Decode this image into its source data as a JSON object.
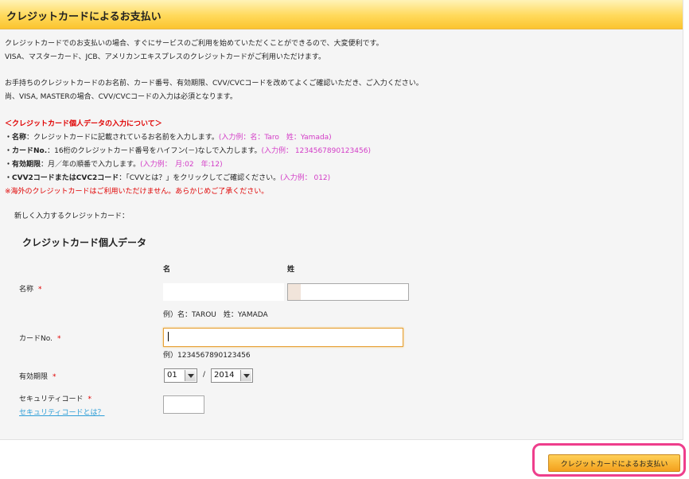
{
  "header": {
    "title": "クレジットカードによるお支払い"
  },
  "intro": {
    "line1": "クレジットカードでのお支払いの場合、すぐにサービスのご利用を始めていただくことができるので、大変便利です。",
    "line2": "VISA、マスターカード、JCB、アメリカンエキスプレスのクレジットカードがご利用いただけます。",
    "line3": "お手持ちのクレジットカードのお名前、カード番号、有効期限、CVV/CVCコードを改めてよくご確認いただき、ご入力ください。",
    "line4": "尚、VISA, MASTERの場合、CVV/CVCコードの入力は必須となります。"
  },
  "notes": {
    "heading": "＜クレジットカード個人データの入力について＞",
    "items": [
      {
        "label": "・名称",
        "text": "：クレジットカードに記載されているお名前を入力します。",
        "example": "(入力例：名：Taro　姓：Yamada)"
      },
      {
        "label": "・カードNo.",
        "text": "：16桁のクレジットカード番号をハイフン(－)なしで入力します。",
        "example": "(入力例： 1234567890123456)"
      },
      {
        "label": "・有効期限",
        "text": "：月／年の順番で入力します。",
        "example": "(入力例：　月:02　年:12)"
      },
      {
        "label": "・CVV2コードまたはCVC2コード",
        "text": "：「CVVとは？」をクリックしてご確認ください。",
        "example": "(入力例： 012)"
      }
    ],
    "warning": "※海外のクレジットカードはご利用いただけません。あらかじめご了承ください。"
  },
  "form": {
    "new_card_label": "新しく入力するクレジットカード：",
    "section_title": "クレジットカード個人データ",
    "col_first": "名",
    "col_last": "姓",
    "name_label": "名称",
    "required_mark": "*",
    "name_example": "例）名：TAROU　姓：YAMADA",
    "card_label": "カードNo.",
    "card_example": "例）1234567890123456",
    "expiry_label": "有効期限",
    "expiry_month": "01",
    "expiry_sep": "/",
    "expiry_year": "2014",
    "security_label": "セキュリティコード",
    "security_link": "セキュリティコードとは？"
  },
  "actions": {
    "pay_button": "クレジットカードによるお支払い"
  },
  "colors": {
    "accent": "#fbc42f",
    "required": "#e00000",
    "example": "#d33cc7",
    "highlight": "#ee3e8c"
  }
}
